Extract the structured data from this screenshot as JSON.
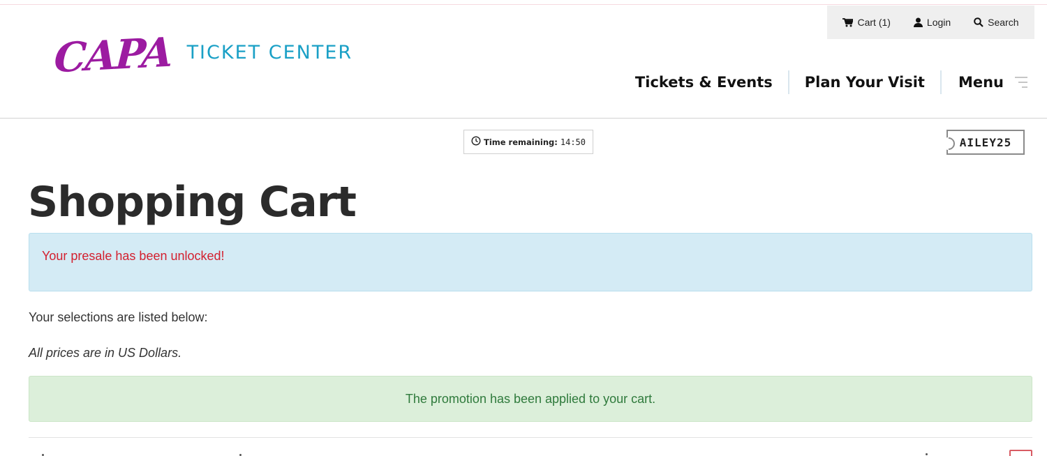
{
  "utility": {
    "cart_label": "Cart (1)",
    "login_label": "Login",
    "search_label": "Search"
  },
  "logo": {
    "capa": "CAPA",
    "ticket_center": "TICKET CENTER"
  },
  "nav": {
    "tickets_events": "Tickets & Events",
    "plan_visit": "Plan Your Visit",
    "menu": "Menu"
  },
  "timer": {
    "label": "Time remaining:",
    "value": "14:50"
  },
  "promo": {
    "code": "AILEY25"
  },
  "page": {
    "title": "Shopping Cart",
    "presale_message": "Your presale has been unlocked!",
    "intro": "Your selections are listed below:",
    "currency_note": "All prices are in US Dollars.",
    "promotion_message": "The promotion has been applied to your cart."
  },
  "colors": {
    "brand_purple": "#9c1ba1",
    "brand_blue": "#1aa0c6",
    "info_bg": "#d4ebf5",
    "info_text": "#d3202f",
    "success_bg": "#dcefda",
    "success_text": "#2f7a3c"
  },
  "icons": {
    "cart": "cart-icon",
    "login": "user-icon",
    "search": "search-icon",
    "timer": "clock-icon",
    "menu": "hamburger-icon"
  }
}
